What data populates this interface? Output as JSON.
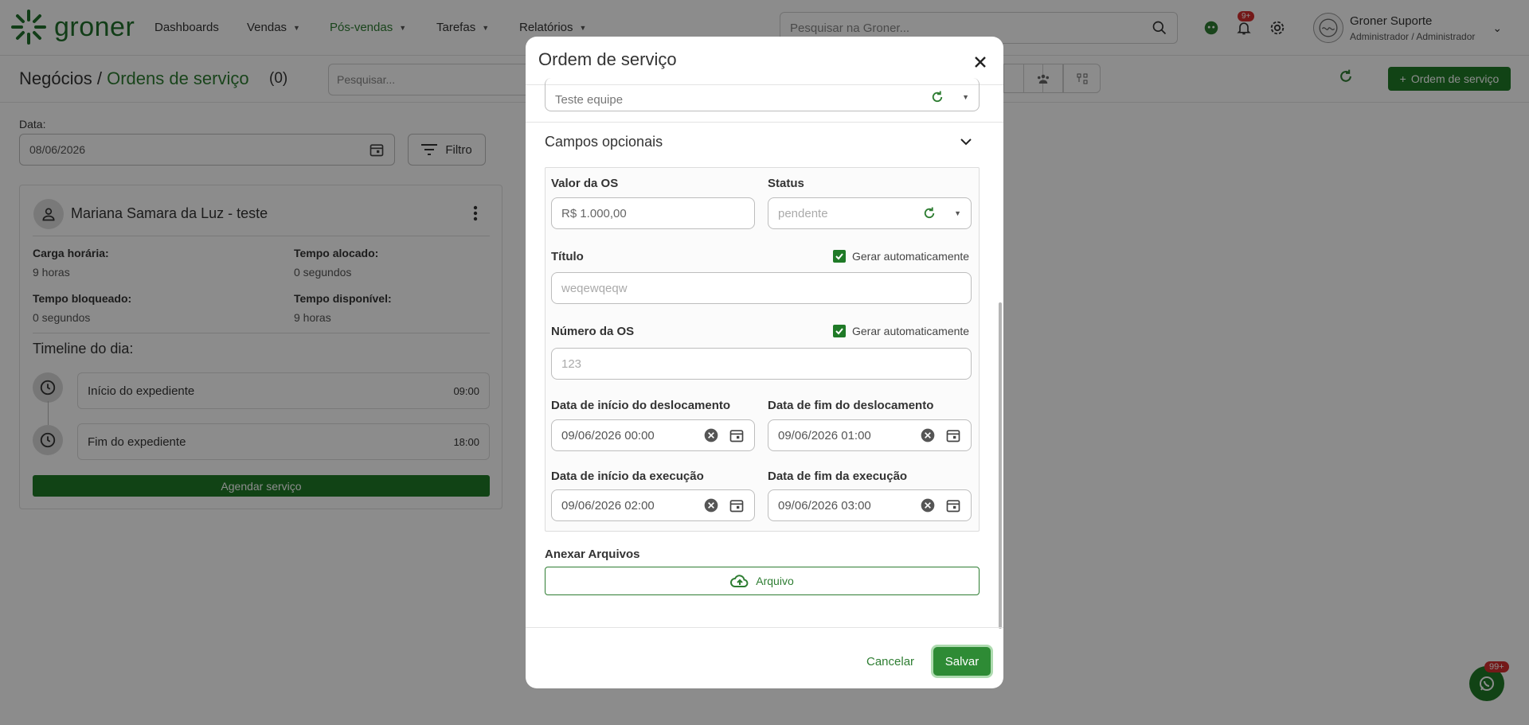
{
  "brand": {
    "name": "groner",
    "color": "#1f6f2a"
  },
  "nav": {
    "items": [
      {
        "label": "Dashboards",
        "has_caret": false
      },
      {
        "label": "Vendas",
        "has_caret": true
      },
      {
        "label": "Pós-vendas",
        "has_caret": true,
        "active": true
      },
      {
        "label": "Tarefas",
        "has_caret": true
      },
      {
        "label": "Relatórios",
        "has_caret": true
      }
    ],
    "search_placeholder": "Pesquisar na Groner...",
    "notification_badge": "9+",
    "user": {
      "name": "Groner Suporte",
      "role": "Administrador / Administrador"
    }
  },
  "page": {
    "breadcrumb_root": "Negócios /",
    "breadcrumb_current": "Ordens de serviço",
    "count": "(0)",
    "search_placeholder": "Pesquisar...",
    "new_button": "Ordem de serviço"
  },
  "filters": {
    "date_label": "Data:",
    "date_value": "08/06/2026",
    "filter_button": "Filtro"
  },
  "card": {
    "person": "Mariana Samara da Luz - teste",
    "stats": [
      {
        "label": "Carga horária:",
        "value": "9 horas"
      },
      {
        "label": "Tempo alocado:",
        "value": "0 segundos"
      },
      {
        "label": "Tempo bloqueado:",
        "value": "0 segundos"
      },
      {
        "label": "Tempo disponível:",
        "value": "9 horas"
      }
    ],
    "timeline_title": "Timeline do dia:",
    "timeline": [
      {
        "label": "Início do expediente",
        "time": "09:00"
      },
      {
        "label": "Fim do expediente",
        "time": "18:00"
      }
    ],
    "schedule_button": "Agendar serviço"
  },
  "whatsapp_badge": "99+",
  "modal": {
    "title": "Ordem de serviço",
    "team_value": "Teste equipe",
    "optional_section": "Campos opcionais",
    "fields": {
      "valor_label": "Valor da OS",
      "valor_value": "R$ 1.000,00",
      "status_label": "Status",
      "status_value": "pendente",
      "titulo_label": "Título",
      "titulo_auto": "Gerar automaticamente",
      "titulo_value": "weqewqeqw",
      "numero_label": "Número da OS",
      "numero_auto": "Gerar automaticamente",
      "numero_value": "123",
      "desloc_inicio_label": "Data de início do deslocamento",
      "desloc_inicio_value": "09/06/2026 00:00",
      "desloc_fim_label": "Data de fim do deslocamento",
      "desloc_fim_value": "09/06/2026 01:00",
      "exec_inicio_label": "Data de início da execução",
      "exec_inicio_value": "09/06/2026 02:00",
      "exec_fim_label": "Data de fim da execução",
      "exec_fim_value": "09/06/2026 03:00"
    },
    "attach_label": "Anexar Arquivos",
    "attach_button": "Arquivo",
    "cancel": "Cancelar",
    "save": "Salvar"
  },
  "colors": {
    "accent": "#2e7d32",
    "primary_button": "#1f7a27",
    "badge": "#d32f2f"
  }
}
